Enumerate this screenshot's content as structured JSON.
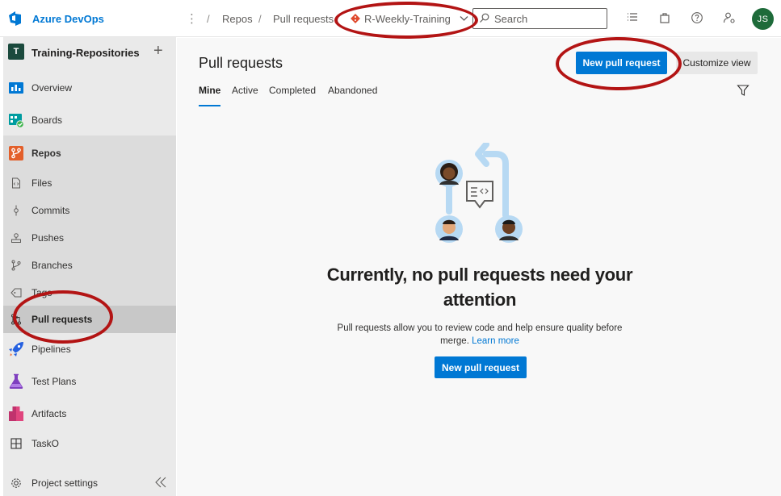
{
  "app": {
    "brand": "Azure DevOps"
  },
  "breadcrumb": {
    "sep": "/",
    "repos": "Repos",
    "pull_requests": "Pull requests",
    "repo_name": "R-Weekly-Training"
  },
  "search": {
    "placeholder": "Search"
  },
  "user": {
    "initials": "JS"
  },
  "project": {
    "badge": "T",
    "name": "Training-Repositories",
    "add": "+"
  },
  "sidebar": {
    "overview": "Overview",
    "boards": "Boards",
    "repos": "Repos",
    "files": "Files",
    "commits": "Commits",
    "pushes": "Pushes",
    "branches": "Branches",
    "tags": "Tags",
    "pull_requests": "Pull requests",
    "pipelines": "Pipelines",
    "test_plans": "Test Plans",
    "artifacts": "Artifacts",
    "tasko": "TaskO",
    "settings": "Project settings"
  },
  "main": {
    "title": "Pull requests",
    "new_pr_label": "New pull request",
    "customize_label": "Customize view",
    "tabs": [
      "Mine",
      "Active",
      "Completed",
      "Abandoned"
    ],
    "empty_title": "Currently, no pull requests need your attention",
    "empty_desc": "Pull requests allow you to review code and help ensure quality before merge.",
    "learn_more": "Learn more"
  },
  "colors": {
    "accent": "#0078d4",
    "annotation": "#b31414",
    "avatar": "#1e6b3a"
  }
}
